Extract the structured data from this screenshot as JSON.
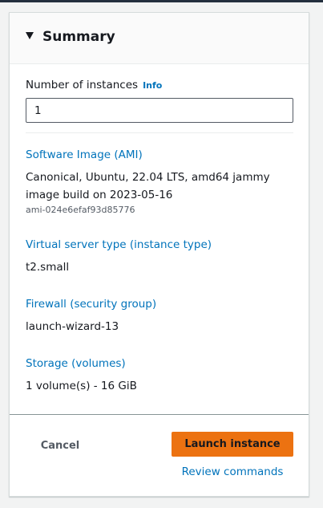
{
  "summary": {
    "title": "Summary",
    "instances": {
      "label": "Number of instances",
      "info_label": "Info",
      "value": "1"
    },
    "software_image": {
      "title": "Software Image (AMI)",
      "description": "Canonical, Ubuntu, 22.04 LTS, amd64 jammy image build on 2023-05-16",
      "ami_id": "ami-024e6efaf93d85776"
    },
    "instance_type": {
      "title": "Virtual server type (instance type)",
      "value": "t2.small"
    },
    "firewall": {
      "title": "Firewall (security group)",
      "value": "launch-wizard-13"
    },
    "storage": {
      "title": "Storage (volumes)",
      "value": "1 volume(s) - 16 GiB"
    }
  },
  "footer": {
    "cancel_label": "Cancel",
    "launch_label": "Launch instance",
    "review_label": "Review commands"
  },
  "colors": {
    "primary_button": "#ec7211",
    "link": "#0073bb",
    "text": "#16191f",
    "secondary_text": "#545b64"
  },
  "icons": {
    "expand": "caret-down-icon"
  }
}
